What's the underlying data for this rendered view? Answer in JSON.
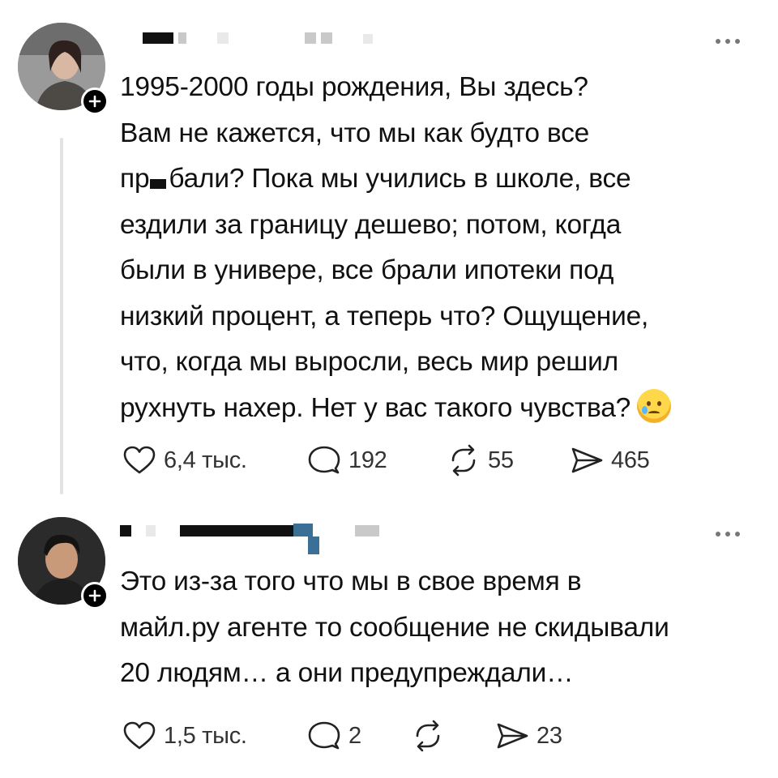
{
  "posts": [
    {
      "text_lines": [
        "1995-2000 годы рождения, Вы здесь?",
        "Вам не кажется, что мы как будто все",
        [
          "пр",
          "бали? Пока мы учились в школе, все"
        ],
        "ездили за границу дешево; потом, когда",
        "были в универе, все брали ипотеки под",
        "низкий процент, а теперь что? Ощущение,",
        "что, когда мы выросли, весь мир решил",
        "рухнуть нахер. Нет у вас такого чувства?"
      ],
      "emoji": "crying-face",
      "actions": {
        "likes": "6,4 тыс.",
        "replies": "192",
        "reposts": "55",
        "shares": "465"
      }
    },
    {
      "text_lines": [
        "Это из-за того что мы в свое время в",
        "майл.ру агенте то сообщение не скидывали",
        "20 людям… а они предупреждали…"
      ],
      "actions": {
        "likes": "1,5 тыс.",
        "replies": "2",
        "reposts": "",
        "shares": "23"
      }
    }
  ],
  "icons": {
    "like": "heart-icon",
    "reply": "speech-bubble-icon",
    "repost": "repost-arrows-icon",
    "share": "send-arrow-icon",
    "more": "more-options-icon",
    "follow": "plus-icon"
  },
  "colors": {
    "text": "#111111",
    "muted": "#333333",
    "thread_line": "#e3e3e3",
    "badge": "#000000"
  }
}
